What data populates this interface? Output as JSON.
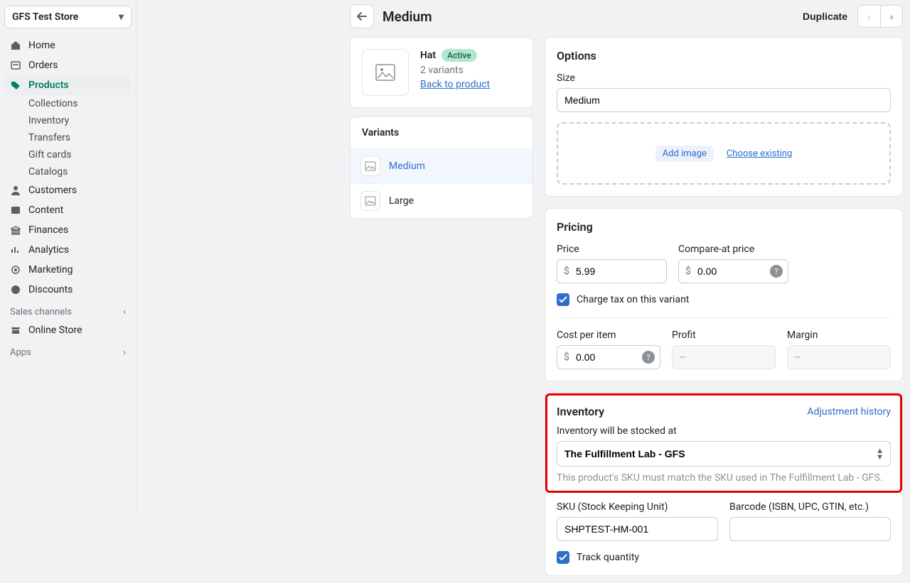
{
  "store": {
    "name": "GFS Test Store"
  },
  "nav": {
    "home": "Home",
    "orders": "Orders",
    "products": "Products",
    "products_sub": [
      "Collections",
      "Inventory",
      "Transfers",
      "Gift cards",
      "Catalogs"
    ],
    "customers": "Customers",
    "content": "Content",
    "finances": "Finances",
    "analytics": "Analytics",
    "marketing": "Marketing",
    "discounts": "Discounts",
    "sales_channels": "Sales channels",
    "online_store": "Online Store",
    "apps": "Apps"
  },
  "header": {
    "title": "Medium",
    "duplicate": "Duplicate"
  },
  "product": {
    "name": "Hat",
    "status": "Active",
    "variant_count_text": "2 variants",
    "back_link": "Back to product"
  },
  "variants": {
    "heading": "Variants",
    "items": [
      {
        "label": "Medium",
        "active": true
      },
      {
        "label": "Large",
        "active": false
      }
    ]
  },
  "options": {
    "heading": "Options",
    "size_label": "Size",
    "size_value": "Medium",
    "add_image": "Add image",
    "choose_existing": "Choose existing"
  },
  "pricing": {
    "heading": "Pricing",
    "price_label": "Price",
    "price_value": "5.99",
    "compare_label": "Compare-at price",
    "compare_value": "0.00",
    "charge_tax": "Charge tax on this variant",
    "cost_label": "Cost per item",
    "cost_value": "0.00",
    "profit_label": "Profit",
    "profit_value": "--",
    "margin_label": "Margin",
    "margin_value": "--"
  },
  "inventory": {
    "heading": "Inventory",
    "adjustment_link": "Adjustment history",
    "stocked_label": "Inventory will be stocked at",
    "stocked_value": "The Fulfillment Lab - GFS",
    "sku_helper": "This product's SKU must match the SKU used in The Fulfillment Lab - GFS.",
    "sku_label": "SKU (Stock Keeping Unit)",
    "sku_value": "SHPTEST-HM-001",
    "barcode_label": "Barcode (ISBN, UPC, GTIN, etc.)",
    "barcode_value": "",
    "track_qty": "Track quantity"
  }
}
